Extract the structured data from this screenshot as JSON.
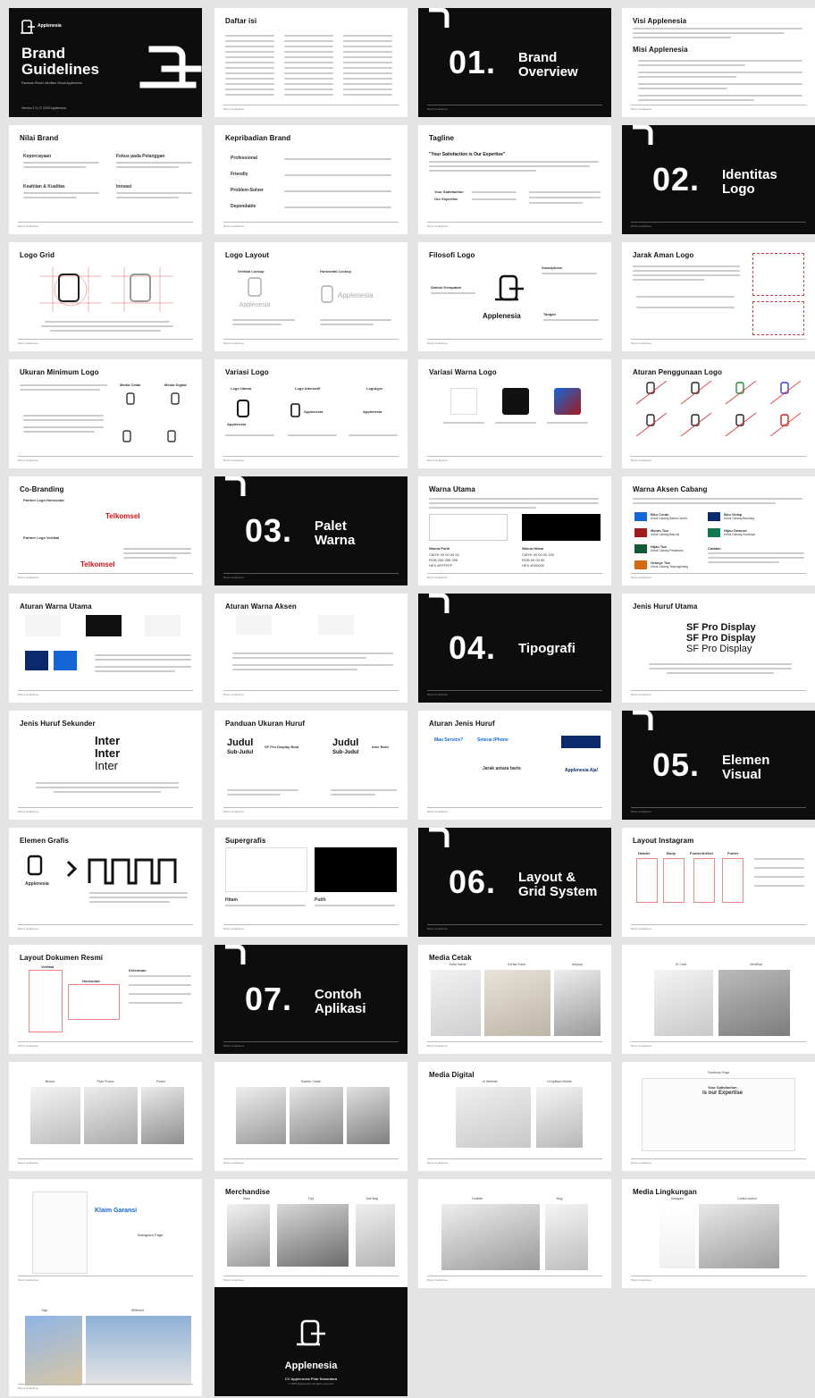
{
  "footer_left": "Brand Guidelines",
  "cover": {
    "brand_small": "Applenesia",
    "title_1": "Brand",
    "title_2": "Guidelines",
    "subtitle": "Panduan Resmi Identitas Visual Applenesia",
    "version": "Version 1.0 | © 2025 Applenesia"
  },
  "sections": [
    {
      "number": "01.",
      "line1": "Brand",
      "line2": "Overview"
    },
    {
      "number": "02.",
      "line1": "Identitas",
      "line2": "Logo"
    },
    {
      "number": "03.",
      "line1": "Palet",
      "line2": "Warna"
    },
    {
      "number": "04.",
      "line1": "Tipografi",
      "line2": ""
    },
    {
      "number": "05.",
      "line1": "Elemen",
      "line2": "Visual"
    },
    {
      "number": "06.",
      "line1": "Layout &",
      "line2": "Grid System"
    },
    {
      "number": "07.",
      "line1": "Contoh",
      "line2": "Aplikasi"
    }
  ],
  "titles": {
    "daftar_isi": "Daftar isi",
    "visi": "Visi Applenesia",
    "misi": "Misi Applenesia",
    "nilai": "Nilai Brand",
    "kepribadian": "Kepribadian Brand",
    "tagline": "Tagline",
    "logo_grid": "Logo Grid",
    "logo_layout": "Logo Layout",
    "filosofi": "Filosofi Logo",
    "jarak_aman": "Jarak Aman Logo",
    "ukuran_min": "Ukuran Minimum Logo",
    "variasi_logo": "Variasi Logo",
    "variasi_warna": "Variasi Warna Logo",
    "aturan_logo": "Aturan Penggunaan Logo",
    "co_branding": "Co-Branding",
    "warna_utama": "Warna Utama",
    "warna_aksen": "Warna Aksen Cabang",
    "aturan_warna_utama": "Aturan Warna Utama",
    "aturan_warna_aksen": "Aturan Warna Aksen",
    "huruf_utama": "Jenis Huruf Utama",
    "huruf_sekunder": "Jenis Huruf Sekunder",
    "ukuran_huruf": "Panduan Ukuran Huruf",
    "aturan_huruf": "Aturan Jenis Huruf",
    "elemen_grafis": "Elemen Grafis",
    "supergrafis": "Supergrafis",
    "layout_ig": "Layout Instagram",
    "layout_dok": "Layout Dokumen Resmi",
    "media_cetak": "Media Cetak",
    "media_digital": "Media Digital",
    "merchandise": "Merchandise",
    "media_lingkungan": "Media Lingkungan"
  },
  "nilai": {
    "items": [
      "Kepercayaan",
      "Fokus pada Pelanggan",
      "Keahlian & Kualitas",
      "Inovasi"
    ]
  },
  "kepribadian": {
    "items": [
      "Professional",
      "Friendly",
      "Problem-Solver",
      "Dependable"
    ]
  },
  "tagline": {
    "quote": "\"Your Satisfaction is Our Expertise\"",
    "k1": "Your Satisfaction",
    "k2": "Our Expertise"
  },
  "logo_layout": {
    "vertical": "Vertikal Lockup",
    "horizontal": "Horizontal Lockup"
  },
  "filosofi": {
    "brand": "Applenesia",
    "smartphone": "Smartphone",
    "tangan": "Tangan",
    "simbol": "Simbol Kerapatan"
  },
  "variasi_logo": {
    "a": "Logo Utama",
    "b": "Logo Alternatif",
    "c": "Logotype",
    "brand": "Applenesia"
  },
  "ukuran_min": {
    "cetak": "Media Cetak",
    "digital": "Media Digital"
  },
  "co_branding": {
    "h": "Partner Logo Horizontal",
    "v": "Partner Logo Vertikal",
    "telkomsel": "Telkomsel"
  },
  "warna_utama": {
    "putih": "Warna Putih",
    "putih_cmyk": "CMYK 00 00 00 00",
    "putih_rgb": "RGB 255 255 255",
    "putih_hex": "HEX #FFFFFF",
    "hitam": "Warna Hitam",
    "hitam_cmyk": "CMYK 00 00 00 100",
    "hitam_rgb": "RGB 00 00 00",
    "hitam_hex": "HEX #000000",
    "white": "#FFFFFF",
    "black": "#000000"
  },
  "warna_aksen": {
    "items": [
      {
        "name": "Biru Cerah",
        "sub": "Untuk Cabang Batam Center",
        "color": "#1466d8"
      },
      {
        "name": "Biru Gelap",
        "sub": "Untuk Cabang Bandung",
        "color": "#0c2a6b"
      },
      {
        "name": "Merah Tua",
        "sub": "Untuk Cabang Batu Aji",
        "color": "#a31a1a"
      },
      {
        "name": "Hijau Zamrud",
        "sub": "Untuk Cabang Surabaya",
        "color": "#0f7a52"
      },
      {
        "name": "Hijau Tua",
        "sub": "Untuk Cabang Pekanbaru",
        "color": "#0f5a34"
      },
      {
        "name": "Oranye Tua",
        "sub": "Untuk Cabang Tanjungpinang",
        "color": "#d9680f"
      }
    ],
    "catatan": "Catatan"
  },
  "huruf_utama": {
    "l1": "SF Pro Display",
    "l2": "SF Pro Display",
    "l3": "SF Pro Display"
  },
  "huruf_sekunder": {
    "l1": "Inter",
    "l2": "Inter",
    "l3": "Inter"
  },
  "ukuran_huruf": {
    "judul": "Judul",
    "sub": "Sub-Judul",
    "sf": "SF Pro Display Bold",
    "inter": "Inter Bold"
  },
  "aturan_huruf": {
    "a": "Mau Service?",
    "b": "Seterai iPhone",
    "c": "Jarak antara baris",
    "d": "Applenesia Aja!"
  },
  "elemen_grafis": {
    "brand": "Applenesia"
  },
  "supergrafis": {
    "hitam": "Hitam",
    "putih": "Putih"
  },
  "layout_ig": {
    "cols": [
      "Header",
      "Body",
      "Footer/Artikel",
      "Footer"
    ]
  },
  "layout_dok": {
    "vertikal": "Vertikal",
    "horizontal": "Horizontal",
    "ketentuan": "Ketentuan"
  },
  "media_cetak": {
    "labels": [
      "Kartu Nama",
      "Kertas Surat",
      "Amplop"
    ]
  },
  "cetak2": {
    "labels": [
      "ID Card",
      "Sertifikat"
    ]
  },
  "cetak3": {
    "labels": [
      "Brosur",
      "Flyer Promo",
      "Poster"
    ]
  },
  "cetak4": {
    "labels": [
      "Banner Cetak"
    ]
  },
  "media_digital": {
    "labels": [
      "UI Website",
      "UI Aplikasi Mobile"
    ]
  },
  "fb": {
    "label": "Facebook Page",
    "tagline_1": "Your Satisfaction",
    "tagline_2": "is our Expertise"
  },
  "ig_page": {
    "label": "Instagram Page",
    "hero": "Klaim Garansi"
  },
  "merch": {
    "labels": [
      "Kaos",
      "Topi",
      "Tote Bag"
    ]
  },
  "merch2": {
    "labels": [
      "Tumbler",
      "Mug"
    ]
  },
  "lingkungan": {
    "labels": [
      "Seragam",
      "Umbul-Umbul"
    ]
  },
  "sign": {
    "labels": [
      "Sign",
      "Billboard"
    ]
  },
  "end": {
    "brand": "Applenesia",
    "company": "CV Applenesia Pilar Nusantara",
    "copy": "© 2025 Applenesia. All rights reserved."
  }
}
